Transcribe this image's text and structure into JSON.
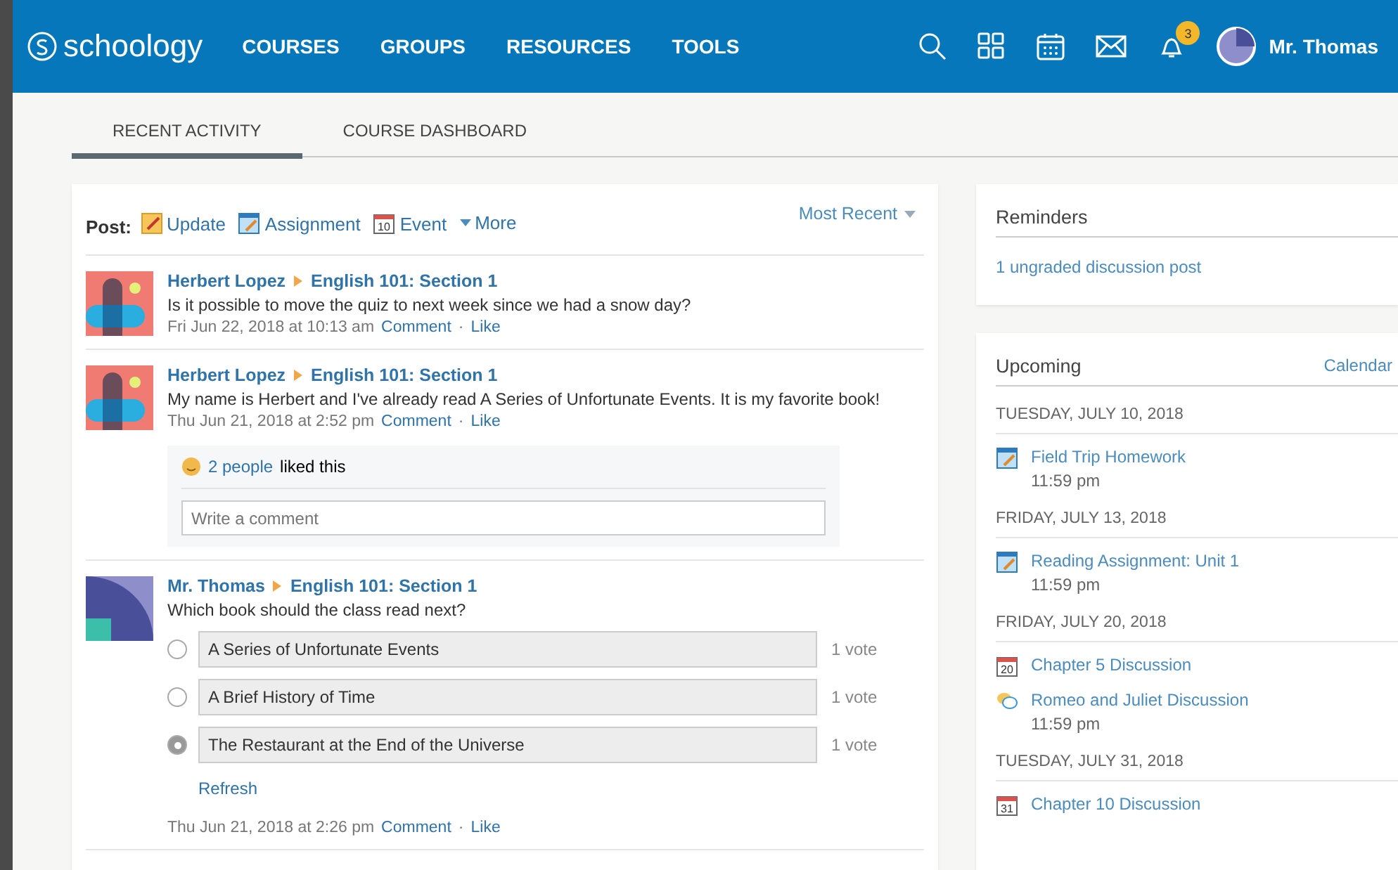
{
  "nav": {
    "logo": "schoology",
    "links": [
      "COURSES",
      "GROUPS",
      "RESOURCES",
      "TOOLS"
    ],
    "notification_count": "3",
    "user": "Mr. Thomas"
  },
  "tabs": [
    {
      "label": "RECENT ACTIVITY",
      "selected": true
    },
    {
      "label": "COURSE DASHBOARD",
      "selected": false
    }
  ],
  "post_bar": {
    "label": "Post:",
    "actions": [
      {
        "kind": "update",
        "label": "Update"
      },
      {
        "kind": "assignment",
        "label": "Assignment"
      },
      {
        "kind": "event",
        "label": "Event",
        "day": "10"
      },
      {
        "kind": "more",
        "label": "More"
      }
    ],
    "sort": "Most Recent"
  },
  "feed": [
    {
      "avatar": {
        "kind": "blocks"
      },
      "author": "Herbert Lopez",
      "course": "English 101: Section 1",
      "text": "Is it possible to move the quiz to next week since we had a snow day?",
      "time": "Fri Jun 22, 2018 at 10:13 am",
      "comment": "Comment",
      "separator": "·",
      "like": "Like"
    },
    {
      "avatar": {
        "kind": "blocks"
      },
      "author": "Herbert Lopez",
      "course": "English 101: Section 1",
      "text": "My name is Herbert and I've already read A Series of Unfortunate Events. It is my favorite book!",
      "time": "Thu Jun 21, 2018 at 2:52 pm",
      "comment": "Comment",
      "separator": "·",
      "like": "Like",
      "likes": {
        "people": "2 people",
        "suffix": "liked this"
      },
      "comment_placeholder": "Write a comment"
    },
    {
      "avatar": {
        "kind": "quarter"
      },
      "author": "Mr. Thomas",
      "course": "English 101: Section 1",
      "text": "Which book should the class read next?",
      "poll": [
        {
          "option": "A Series of Unfortunate Events",
          "votes": "1 vote",
          "selected": false
        },
        {
          "option": "A Brief History of Time",
          "votes": "1 vote",
          "selected": false
        },
        {
          "option": "The Restaurant at the End of the Universe",
          "votes": "1 vote",
          "selected": true
        }
      ],
      "refresh": "Refresh",
      "time": "Thu Jun 21, 2018 at 2:26 pm",
      "comment": "Comment",
      "separator": "·",
      "like": "Like"
    }
  ],
  "reminders": {
    "title": "Reminders",
    "items": [
      "1 ungraded discussion post"
    ]
  },
  "upcoming": {
    "title": "Upcoming",
    "link": "Calendar",
    "days": [
      {
        "date": "TUESDAY, JULY 10, 2018",
        "items": [
          {
            "kind": "assignment",
            "title": "Field Trip Homework",
            "time": "11:59 pm"
          }
        ]
      },
      {
        "date": "FRIDAY, JULY 13, 2018",
        "items": [
          {
            "kind": "assignment",
            "title": "Reading Assignment: Unit 1",
            "time": "11:59 pm"
          }
        ]
      },
      {
        "date": "FRIDAY, JULY 20, 2018",
        "items": [
          {
            "kind": "event",
            "day": "20",
            "title": "Chapter 5 Discussion"
          },
          {
            "kind": "discussion",
            "title": "Romeo and Juliet Discussion",
            "time": "11:59 pm"
          }
        ]
      },
      {
        "date": "TUESDAY, JULY 31, 2018",
        "items": [
          {
            "kind": "event",
            "day": "31",
            "title": "Chapter 10 Discussion"
          }
        ]
      }
    ]
  }
}
